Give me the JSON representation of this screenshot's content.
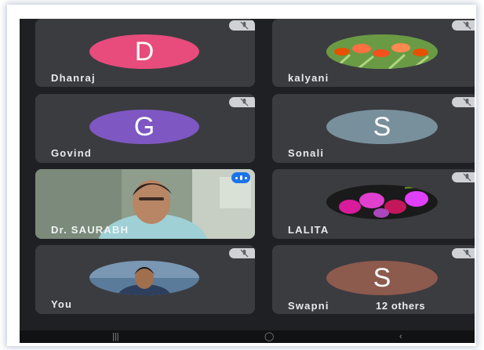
{
  "participants": [
    {
      "name": "Dhanraj",
      "initial": "D",
      "avatar_color": "#e74c7c",
      "muted": true
    },
    {
      "name": "kalyani",
      "initial": "",
      "avatar_color": "#4a7a3a",
      "muted": true,
      "avatar_type": "photo-flowers-orange"
    },
    {
      "name": "Govind",
      "initial": "G",
      "avatar_color": "#7e57c2",
      "muted": true
    },
    {
      "name": "Sonali",
      "initial": "S",
      "avatar_color": "#78909c",
      "muted": true
    },
    {
      "name": "Dr. SAURABH",
      "initial": "",
      "avatar_color": "#6b7a6a",
      "muted": false,
      "speaking": true,
      "avatar_type": "video"
    },
    {
      "name": "LALITA",
      "initial": "",
      "avatar_color": "#6a1b6a",
      "muted": true,
      "avatar_type": "photo-flowers-pink"
    },
    {
      "name": "You",
      "initial": "",
      "avatar_color": "#4a6a8a",
      "muted": true,
      "avatar_type": "photo-person"
    },
    {
      "name": "Swapni",
      "initial": "S",
      "avatar_color": "#8d5a4e",
      "muted": true,
      "others_label": "12 others"
    }
  ],
  "icons": {
    "mute": "mic-off-icon",
    "speaking": "audio-level-icon"
  },
  "nav": {
    "recents": "nav-recents-icon",
    "home": "nav-home-icon",
    "back": "nav-back-icon"
  }
}
